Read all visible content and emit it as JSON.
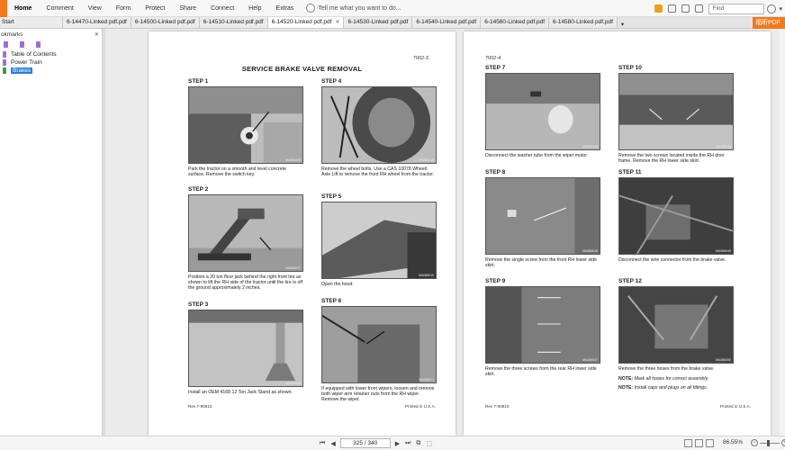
{
  "menubar": {
    "items": [
      "Home",
      "Comment",
      "View",
      "Form",
      "Protect",
      "Share",
      "Connect",
      "Help",
      "Extras"
    ],
    "tell_me_placeholder": "Tell me what you want to do...",
    "find_placeholder": "Find"
  },
  "tabs": {
    "start_label": "Start",
    "items": [
      "6-14470-Linked pdf.pdf",
      "6-14500-Linked pdf.pdf",
      "6-14510-Linked pdf.pdf",
      "6-14520-Linked pdf.pdf",
      "6-14530-Linked pdf.pdf",
      "6-14540-Linked pdf.pdf",
      "6-14560-Linked pdf.pdf",
      "6-14580-Linked pdf.pdf"
    ],
    "active_index": 3,
    "brand_label": "福昕PDF"
  },
  "bookmarks": {
    "header": "okmarks",
    "items": [
      {
        "label": "Table of Contents",
        "selected": false
      },
      {
        "label": "Power Train",
        "selected": false
      },
      {
        "label": "Brakes",
        "selected": true
      }
    ]
  },
  "page_left": {
    "page_number": "7002-3",
    "title": "SERVICE BRAKE VALVE REMOVAL",
    "steps": [
      {
        "heading": "STEP 1",
        "fig": "MA086269",
        "caption": "Park the tractor on a smooth and level concrete surface. Remove the switch key."
      },
      {
        "heading": "STEP 2",
        "fig": "MA086007",
        "caption": "Position a 20 ton floor jack behind the right front tire as shown to lift the RH side of the tractor until the tire is off the ground approximately 2 inches."
      },
      {
        "heading": "STEP 3",
        "fig": "MA086008",
        "caption": "Install an OEM 4168 12 Ton Jack Stand as shown."
      },
      {
        "heading": "STEP 4",
        "fig": "MA082118",
        "caption": "Remove the wheel bolts. Use a CAS 10078 Wheel/ Axle Lift to remove the front RH wheel from the tractor."
      },
      {
        "heading": "STEP 5",
        "fig": "MA086010",
        "caption": "Open the hood."
      },
      {
        "heading": "STEP 6",
        "fig": "MA086011",
        "caption": "If equipped with lower front wipers, loosen and remove both wiper arm retainer nuts from the RH wiper. Remove the wiper."
      }
    ],
    "footer_left": "Rev 7-90813",
    "footer_right": "Printed in U.S.A."
  },
  "page_right": {
    "page_number": "7002-4",
    "steps": [
      {
        "heading": "STEP 7",
        "fig": "MA086045",
        "caption": "Disconnect the washer tube from the wiper motor."
      },
      {
        "heading": "STEP 8",
        "fig": "MA086046",
        "caption": "Remove the single screw from the front RH lower side skirt."
      },
      {
        "heading": "STEP 9",
        "fig": "MA086047",
        "caption": "Remove the three screws from the rear RH lower side skirt."
      },
      {
        "heading": "STEP 10",
        "fig": "MA086048",
        "caption": "Remove the two screws located inside the RH door frame. Remove the RH lower side skirt."
      },
      {
        "heading": "STEP 11",
        "fig": "MA086049",
        "caption": "Disconnect the wire connector from the brake valve."
      },
      {
        "heading": "STEP 12",
        "fig": "MA086050",
        "caption": "Remove the three hoses from the brake valve."
      }
    ],
    "notes": [
      {
        "label": "NOTE:",
        "text": "Mark all hoses for correct assembly."
      },
      {
        "label": "NOTE:",
        "text": "Install caps and plugs on all fittings."
      }
    ],
    "footer_left": "Rev 7-90813",
    "footer_right": "Printed in U.S.A."
  },
  "statusbar": {
    "page_indicator": "325 / 340",
    "zoom": "86.55%"
  },
  "colors": {
    "accent": "#f27a1a",
    "selection": "#2f7bd5",
    "bookmark_icon": "#a070d6"
  }
}
